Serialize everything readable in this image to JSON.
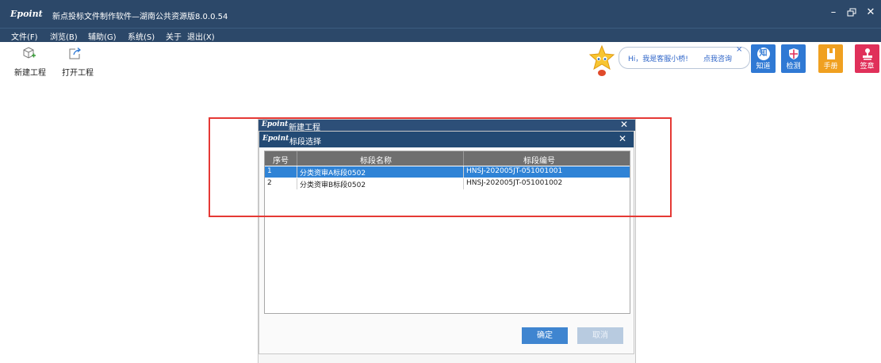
{
  "window": {
    "logo": "Epoint",
    "title": "新点投标文件制作软件—湖南公共资源版8.0.0.54",
    "controls": [
      "minimize-icon",
      "restore-icon",
      "close-icon"
    ]
  },
  "menu": {
    "items": [
      "文件(F)",
      "浏览(B)",
      "辅助(G)",
      "系统(S)",
      "关于",
      "退出(X)"
    ]
  },
  "toolbar": {
    "new_project": "新建工程",
    "open_project": "打开工程"
  },
  "assistant": {
    "greeting": "Hi，我是客服小桥!",
    "ask": "点我咨询",
    "close": "×"
  },
  "quick_buttons": [
    {
      "label": "知道",
      "color": "#2f79d4",
      "glyph": "知"
    },
    {
      "label": "检测",
      "color": "#2f79d4"
    },
    {
      "label": "手册",
      "color": "#f0a020"
    },
    {
      "label": "签章",
      "color": "#e0305a"
    }
  ],
  "dialog_back": {
    "logo": "Epoint",
    "title": "新建工程",
    "close": "✕"
  },
  "dialog": {
    "logo": "Epoint",
    "title": "标段选择",
    "close": "✕",
    "columns": [
      "序号",
      "标段名称",
      "标段编号"
    ],
    "rows": [
      {
        "index": "1",
        "name": "分类资审A标段0502",
        "code": "HNSJ-202005JT-051001001",
        "selected": true
      },
      {
        "index": "2",
        "name": "分类资审B标段0502",
        "code": "HNSJ-202005JT-051001002",
        "selected": false
      }
    ],
    "ok_label": "确定",
    "cancel_label": "取消"
  },
  "colors": {
    "titlebar": "#2c4869",
    "selection": "#2f83d6",
    "highlight": "#e53935"
  }
}
